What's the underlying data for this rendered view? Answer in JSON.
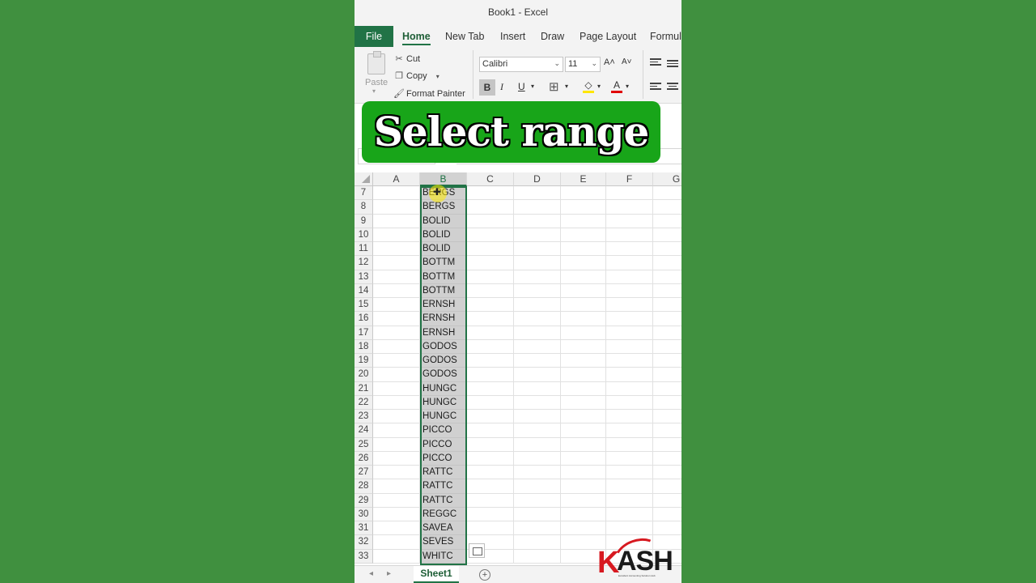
{
  "window": {
    "title": "Book1  -  Excel"
  },
  "tabs": [
    {
      "label": "File"
    },
    {
      "label": "Home"
    },
    {
      "label": "New Tab"
    },
    {
      "label": "Insert"
    },
    {
      "label": "Draw"
    },
    {
      "label": "Page Layout"
    },
    {
      "label": "Formul"
    }
  ],
  "ribbon": {
    "paste_label": "Paste",
    "cut_label": "Cut",
    "copy_label": "Copy",
    "format_painter_label": "Format Painter",
    "font_name": "Calibri",
    "font_size": "11",
    "bold": "B",
    "italic": "I",
    "underline": "U",
    "grow_font": "A˄",
    "shrink_font": "A˅"
  },
  "banner": {
    "text": "Select range"
  },
  "columns": [
    "A",
    "B",
    "C",
    "D",
    "E",
    "F",
    "G"
  ],
  "selected_column": "B",
  "rows": [
    {
      "num": "7",
      "b": "BERGS"
    },
    {
      "num": "8",
      "b": "BERGS"
    },
    {
      "num": "9",
      "b": "BOLID"
    },
    {
      "num": "10",
      "b": "BOLID"
    },
    {
      "num": "11",
      "b": "BOLID"
    },
    {
      "num": "12",
      "b": "BOTTM"
    },
    {
      "num": "13",
      "b": "BOTTM"
    },
    {
      "num": "14",
      "b": "BOTTM"
    },
    {
      "num": "15",
      "b": "ERNSH"
    },
    {
      "num": "16",
      "b": "ERNSH"
    },
    {
      "num": "17",
      "b": "ERNSH"
    },
    {
      "num": "18",
      "b": "GODOS"
    },
    {
      "num": "19",
      "b": "GODOS"
    },
    {
      "num": "20",
      "b": "GODOS"
    },
    {
      "num": "21",
      "b": "HUNGC"
    },
    {
      "num": "22",
      "b": "HUNGC"
    },
    {
      "num": "23",
      "b": "HUNGC"
    },
    {
      "num": "24",
      "b": "PICCO"
    },
    {
      "num": "25",
      "b": "PICCO"
    },
    {
      "num": "26",
      "b": "PICCO"
    },
    {
      "num": "27",
      "b": "RATTC"
    },
    {
      "num": "28",
      "b": "RATTC"
    },
    {
      "num": "29",
      "b": "RATTC"
    },
    {
      "num": "30",
      "b": "REGGC"
    },
    {
      "num": "31",
      "b": "SAVEA"
    },
    {
      "num": "32",
      "b": "SEVES"
    },
    {
      "num": "33",
      "b": "WHITC"
    }
  ],
  "sheet_tab": "Sheet1",
  "logo": {
    "k": "K",
    "rest": "ASH",
    "tagline": "Excellent Accounting Solution Hub"
  },
  "colors": {
    "excel_green": "#217346",
    "banner_green": "#18a519",
    "background_green": "#40903f",
    "logo_red": "#d71920"
  }
}
